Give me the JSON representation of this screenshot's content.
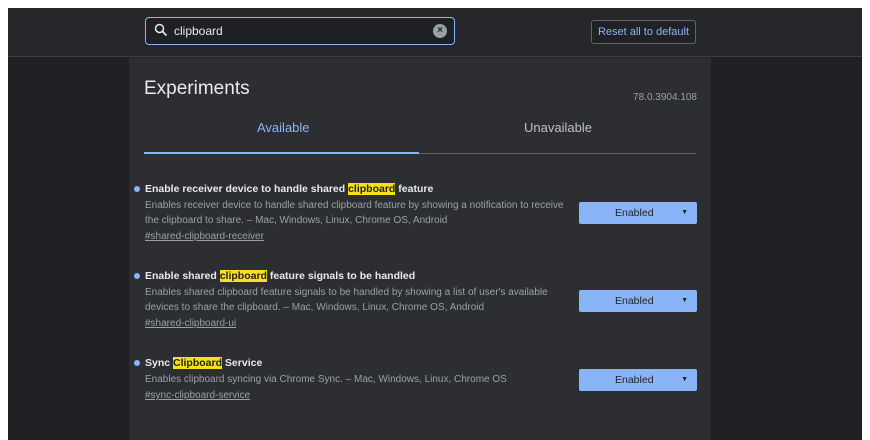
{
  "search": {
    "value": "clipboard",
    "icon": "search-icon",
    "clear_icon": "clear-icon",
    "clear_glyph": "×"
  },
  "header": {
    "reset_label": "Reset all to default"
  },
  "page": {
    "title": "Experiments",
    "version": "78.0.3904.108"
  },
  "tabs": [
    {
      "label": "Available",
      "active": true
    },
    {
      "label": "Unavailable",
      "active": false
    }
  ],
  "experiments": [
    {
      "name_before": "Enable receiver device to handle shared ",
      "name_highlight": "clipboard",
      "name_after": " feature",
      "description": "Enables receiver device to handle shared clipboard feature by showing a notification to receive the clipboard to share. – Mac, Windows, Linux, Chrome OS, Android",
      "link": "#shared-clipboard-receiver",
      "select_value": "Enabled"
    },
    {
      "name_before": "Enable shared ",
      "name_highlight": "clipboard",
      "name_after": " feature signals to be handled",
      "description": "Enables shared clipboard feature signals to be handled by showing a list of user's available devices to share the clipboard. – Mac, Windows, Linux, Chrome OS, Android",
      "link": "#shared-clipboard-ui",
      "select_value": "Enabled"
    },
    {
      "name_before": "Sync ",
      "name_highlight": "Clipboard",
      "name_after": " Service",
      "description": "Enables clipboard syncing via Chrome Sync. – Mac, Windows, Linux, Chrome OS",
      "link": "#sync-clipboard-service",
      "select_value": "Enabled"
    }
  ],
  "colors": {
    "background": "#202124",
    "panel": "#2d2e31",
    "accent": "#8ab4f8",
    "highlight": "#f8e11b",
    "text_primary": "#e8eaed",
    "text_secondary": "#9aa0a6"
  }
}
